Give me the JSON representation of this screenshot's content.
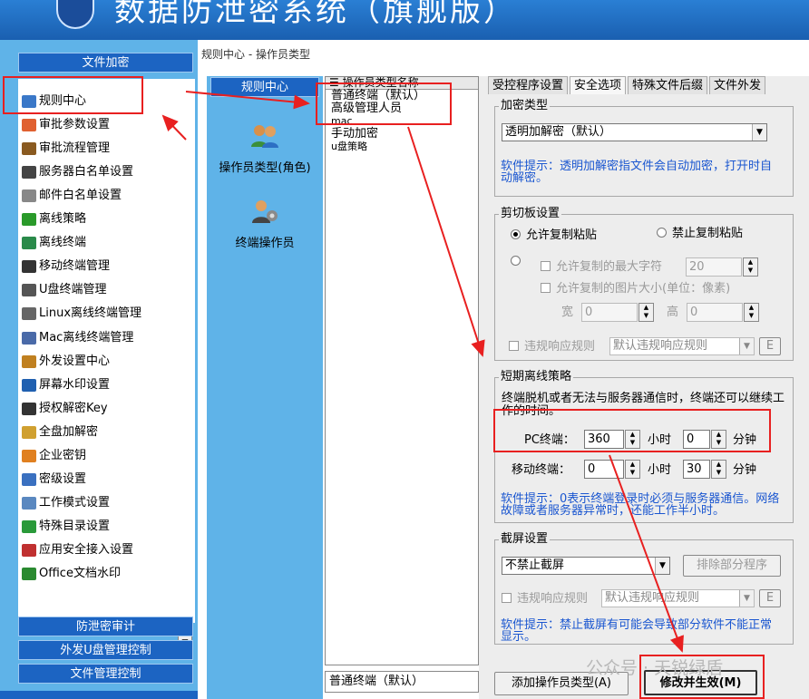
{
  "app": {
    "title": "数据防泄密系统（旗舰版）"
  },
  "left": {
    "header": "文件加密",
    "items": [
      "规则中心",
      "审批参数设置",
      "审批流程管理",
      "服务器白名单设置",
      "邮件白名单设置",
      "离线策略",
      "离线终端",
      "移动终端管理",
      "U盘终端管理",
      "Linux离线终端管理",
      "Mac离线终端管理",
      "外发设置中心",
      "屏幕水印设置",
      "授权解密Key",
      "全盘加解密",
      "企业密钥",
      "密级设置",
      "工作模式设置",
      "特殊目录设置",
      "应用安全接入设置",
      "Office文档水印"
    ],
    "sections": [
      "防泄密审计",
      "外发U盘管理控制",
      "文件管理控制"
    ]
  },
  "breadcrumb": "规则中心 - 操作员类型",
  "mid": {
    "header": "规则中心",
    "items": [
      "操作员类型(角色)",
      "终端操作员"
    ]
  },
  "roles": {
    "column": "操作员类型名称",
    "items": [
      "普通终端（默认）",
      "高级管理人员",
      "mac",
      "手动加密",
      "u盘策略"
    ],
    "current": "普通终端（默认）"
  },
  "tabs": [
    "受控程序设置",
    "安全选项",
    "特殊文件后缀",
    "文件外发"
  ],
  "encrypt": {
    "label": "加密类型",
    "value": "透明加解密（默认）",
    "hint": "软件提示：透明加解密指文件会自动加密，打开时自动解密。"
  },
  "clipboard": {
    "label": "剪切板设置",
    "allow": "允许复制粘贴",
    "forbid": "禁止复制粘贴",
    "max_chars_label": "允许复制的最大字符",
    "max_chars": "20",
    "image_label": "允许复制的图片大小(单位：像素)",
    "width_label": "宽",
    "width": "0",
    "height_label": "高",
    "height": "0",
    "violation_label": "违规响应规则",
    "violation_value": "默认违规响应规则",
    "e_btn": "E"
  },
  "offline": {
    "label": "短期离线策略",
    "desc": "终端脱机或者无法与服务器通信时，终端还可以继续工作的时间。",
    "pc_label": "PC终端：",
    "pc_hours": "360",
    "pc_minutes": "0",
    "mobile_label": "移动终端：",
    "mobile_hours": "0",
    "mobile_minutes": "30",
    "hours_unit": "小时",
    "minutes_unit": "分钟",
    "hint": "软件提示：0表示终端登录时必须与服务器通信。网络故障或者服务器异常时，还能工作半小时。"
  },
  "screenshot": {
    "label": "截屏设置",
    "value": "不禁止截屏",
    "exclude_btn": "排除部分程序",
    "violation_label": "违规响应规则",
    "violation_value": "默认违规响应规则",
    "e_btn": "E",
    "hint": "软件提示：禁止截屏有可能会导致部分软件不能正常显示。"
  },
  "buttons": {
    "add": "添加操作员类型(A)",
    "apply": "修改并生效(M)"
  },
  "watermark": "公众号 · 天锐绿盾",
  "colors": {
    "highlight": "#e82020",
    "hint": "#1a56d0",
    "nav_blue": "#1c64c2"
  }
}
